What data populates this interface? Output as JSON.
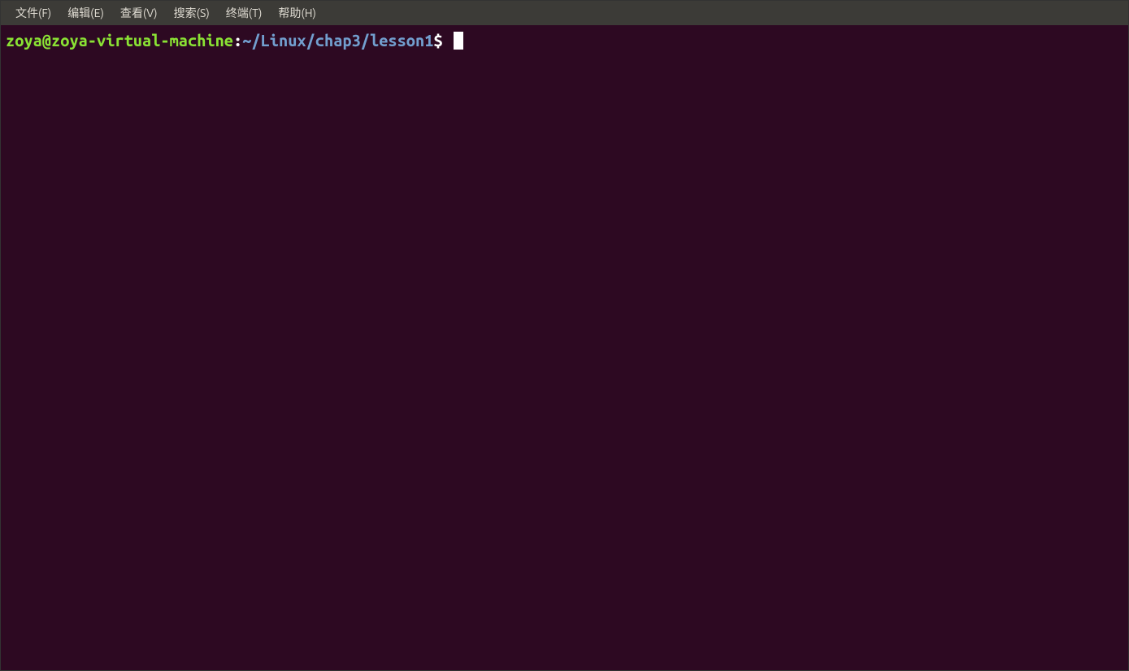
{
  "menubar": {
    "items": [
      "文件(F)",
      "编辑(E)",
      "查看(V)",
      "搜索(S)",
      "终端(T)",
      "帮助(H)"
    ]
  },
  "terminal": {
    "prompt": {
      "user_host": "zoya@zoya-virtual-machine",
      "separator": ":",
      "path": "~/Linux/chap3/lesson1",
      "symbol": "$"
    },
    "input": ""
  },
  "colors": {
    "menubar_bg": "#3c3b37",
    "menubar_fg": "#dfdbd2",
    "terminal_bg": "#2d0922",
    "prompt_user": "#8ae234",
    "prompt_path": "#729fcf",
    "text": "#ffffff"
  }
}
